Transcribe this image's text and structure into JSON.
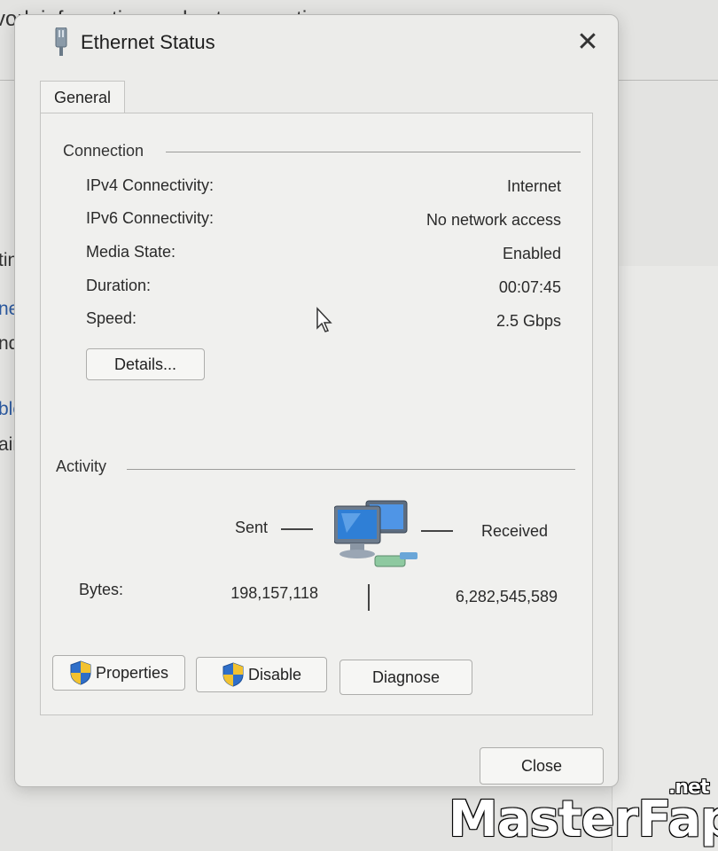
{
  "background": {
    "title_fragment": "vork information and set connection",
    "fragments": [
      {
        "text": "tin",
        "link": false
      },
      {
        "text": "nec",
        "link": true
      },
      {
        "text": "nd,",
        "link": false
      },
      {
        "text": "ble",
        "link": true
      },
      {
        "text": "air",
        "link": false
      }
    ]
  },
  "dialog": {
    "title": "Ethernet Status",
    "close_icon": "close-icon",
    "tab": "General",
    "connection": {
      "group_label": "Connection",
      "rows": [
        {
          "label": "IPv4 Connectivity:",
          "value": "Internet"
        },
        {
          "label": "IPv6 Connectivity:",
          "value": "No network access"
        },
        {
          "label": "Media State:",
          "value": "Enabled"
        },
        {
          "label": "Duration:",
          "value": "00:07:45"
        },
        {
          "label": "Speed:",
          "value": "2.5 Gbps"
        }
      ],
      "details_button": "Details..."
    },
    "activity": {
      "group_label": "Activity",
      "sent_label": "Sent",
      "received_label": "Received",
      "bytes_label": "Bytes:",
      "bytes_sent": "198,157,118",
      "bytes_received": "6,282,545,589"
    },
    "buttons": {
      "properties": "Properties",
      "disable": "Disable",
      "diagnose": "Diagnose",
      "close": "Close"
    }
  },
  "watermark": {
    "text": "MasterFap",
    "suffix": ".net"
  },
  "colors": {
    "shield_blue": "#2f6fc9",
    "shield_yellow": "#f2c230",
    "monitor_blue": "#2f7fd6"
  }
}
